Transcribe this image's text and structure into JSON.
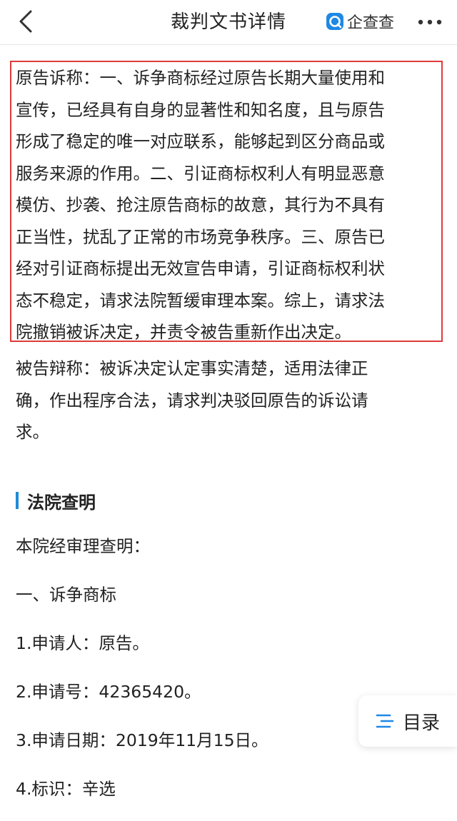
{
  "header": {
    "title": "裁判文书详情",
    "brand_text": "企查查",
    "back_icon": "chevron-left-icon",
    "brand_icon": "qichacha-logo-icon",
    "more_icon": "more-dots-icon"
  },
  "document": {
    "plaintiff_lines": [
      "原告诉称：一、诉争商标经过原告长期大量使用和",
      "宣传，已经具有自身的显著性和知名度，且与原告",
      "形成了稳定的唯一对应联系，能够起到区分商品或",
      "服务来源的作用。二、引证商标权利人有明显恶意",
      "模仿、抄袭、抢注原告商标的故意，其行为不具有",
      "正当性，扰乱了正常的市场竞争秩序。三、原告已",
      "经对引证商标提出无效宣告申请，引证商标权利状",
      "态不稳定，请求法院暂缓审理本案。综上，请求法",
      "院撤销被诉决定，并责令被告重新作出决定。"
    ],
    "defendant_lines": [
      "被告辩称：被诉决定认定事实清楚，适用法律正",
      "确，作出程序合法，请求判决驳回原告的诉讼请",
      "求。"
    ],
    "section_title": "法院查明",
    "findings": [
      "本院经审理查明：",
      "一、诉争商标",
      "1.申请人：原告。",
      "2.申请号：42365420。",
      "3.申请日期：2019年11月15日。",
      "4.标识：辛选"
    ]
  },
  "toc": {
    "label": "目录",
    "icon": "toc-list-icon"
  },
  "colors": {
    "highlight_border": "#e03a3a",
    "section_accent": "#1f8bd8",
    "brand_blue": "#1e88e5"
  }
}
